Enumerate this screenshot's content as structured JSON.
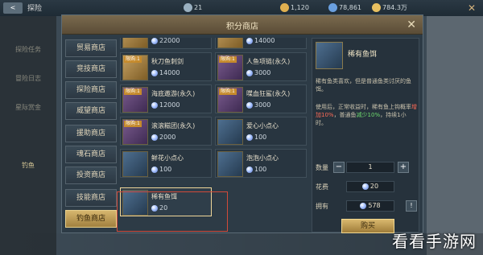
{
  "topbar": {
    "back_label": "<",
    "title": "探险",
    "resources": [
      {
        "value": "21",
        "color": "#9ab0c0"
      },
      {
        "value": "1,120",
        "color": "#e0b050"
      },
      {
        "value": "78,861",
        "color": "#6aa0e0"
      },
      {
        "value": "784.3万",
        "color": "#e8c060"
      }
    ]
  },
  "background_left": [
    "探险任务",
    "冒险日志",
    "星际赏金",
    "钓鱼"
  ],
  "modal": {
    "title": "积分商店",
    "close": "✕"
  },
  "tabs": [
    {
      "label": "贸易商店",
      "active": false
    },
    {
      "label": "竞技商店",
      "active": false
    },
    {
      "label": "探险商店",
      "active": false
    },
    {
      "label": "威望商店",
      "active": false
    },
    {
      "label": "援助商店",
      "active": false
    },
    {
      "label": "魂石商店",
      "active": false
    },
    {
      "label": "投资商店",
      "active": false
    },
    {
      "label": "技能商店",
      "active": false
    },
    {
      "label": "钓鱼商店",
      "active": true
    }
  ],
  "items": [
    {
      "name": "",
      "price": "22000",
      "limit": "",
      "style": "gold"
    },
    {
      "name": "",
      "price": "14000",
      "limit": "",
      "style": "gold"
    },
    {
      "name": "秋刀鱼刺剑",
      "price": "14000",
      "limit": "限购:1",
      "style": "gold"
    },
    {
      "name": "人鱼项链(永久)",
      "price": "3000",
      "limit": "限购:1",
      "style": "purple"
    },
    {
      "name": "海底遨游(永久)",
      "price": "12000",
      "limit": "限购:1",
      "style": "purple"
    },
    {
      "name": "喋血狂鲨(永久)",
      "price": "3000",
      "limit": "限购:1",
      "style": "purple"
    },
    {
      "name": "滚滚糍团(永久)",
      "price": "2000",
      "limit": "限购:1",
      "style": "purple"
    },
    {
      "name": "爱心小点心",
      "price": "100",
      "limit": "",
      "style": "blue"
    },
    {
      "name": "鲜花小点心",
      "price": "100",
      "limit": "",
      "style": "blue"
    },
    {
      "name": "泡泡小点心",
      "price": "100",
      "limit": "",
      "style": "blue"
    },
    {
      "name": "稀有鱼饵",
      "price": "20",
      "limit": "",
      "style": "blue"
    }
  ],
  "detail": {
    "name": "稀有鱼饵",
    "description": "稀有鱼类喜欢，但是普通鱼类讨厌的鱼饵。",
    "usage_pre": "使用后，正常收益时，稀有鱼上钩概率",
    "usage_inc": "增加10%",
    "usage_mid": "，普通鱼",
    "usage_dec": "减少10%",
    "usage_post": "，持续1小时。",
    "qty_label": "数量",
    "qty_value": "1",
    "minus": "−",
    "plus": "+",
    "cost_label": "花费",
    "cost_value": "20",
    "own_label": "拥有",
    "own_value": "578",
    "info": "!",
    "buy_label": "购买"
  },
  "watermark": "看看手游网"
}
